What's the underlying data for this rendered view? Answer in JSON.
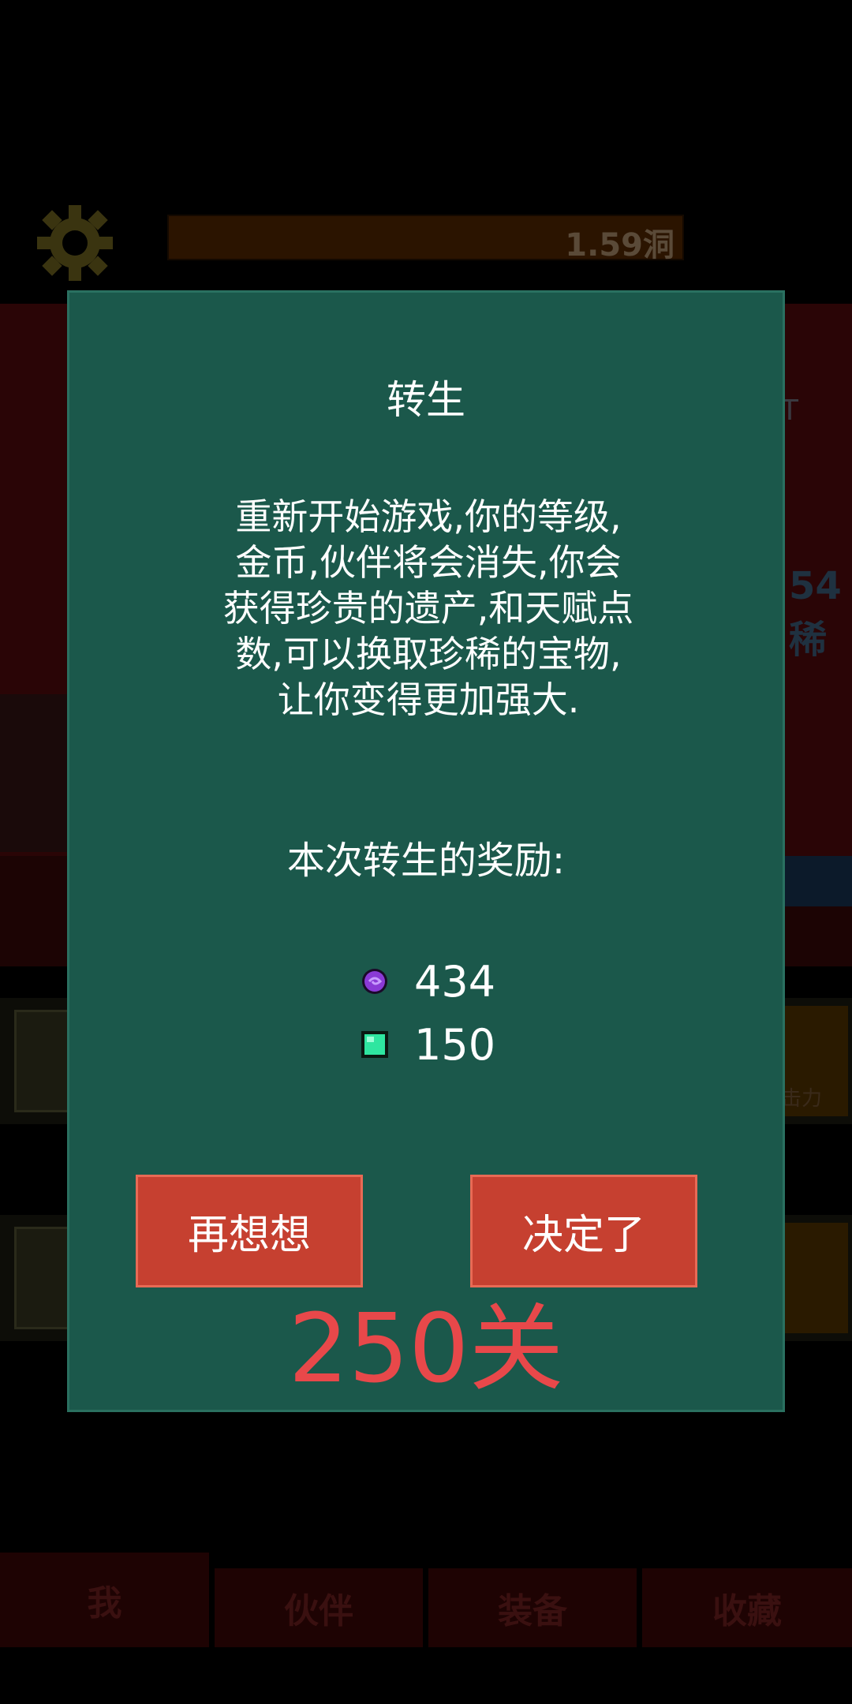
{
  "background": {
    "top_bar_value": "1.59洞",
    "side_text_right": "T",
    "side_text_right2": "54稀",
    "side_small": "击力",
    "nav_tabs": [
      "我",
      "伙伴",
      "装备",
      "收藏"
    ]
  },
  "dialog": {
    "title": "转生",
    "body_lines": [
      "重新开始游戏,你的等级,",
      "金币,伙伴将会消失,你会",
      "获得珍贵的遗产,和天赋点",
      "数,可以换取珍稀的宝物,",
      "让你变得更加强大."
    ],
    "reward_heading": "本次转生的奖励:",
    "rewards": [
      {
        "icon": "purple-orb-icon",
        "value": "434",
        "color": "#8a3ad6"
      },
      {
        "icon": "green-gem-icon",
        "value": "150",
        "color": "#2fe6a0"
      }
    ],
    "cancel_label": "再想想",
    "confirm_label": "决定了",
    "stage_label": "250关"
  },
  "colors": {
    "dialog_bg": "#1b584b",
    "button_bg": "#c64030",
    "stage_text": "#e8484a"
  }
}
